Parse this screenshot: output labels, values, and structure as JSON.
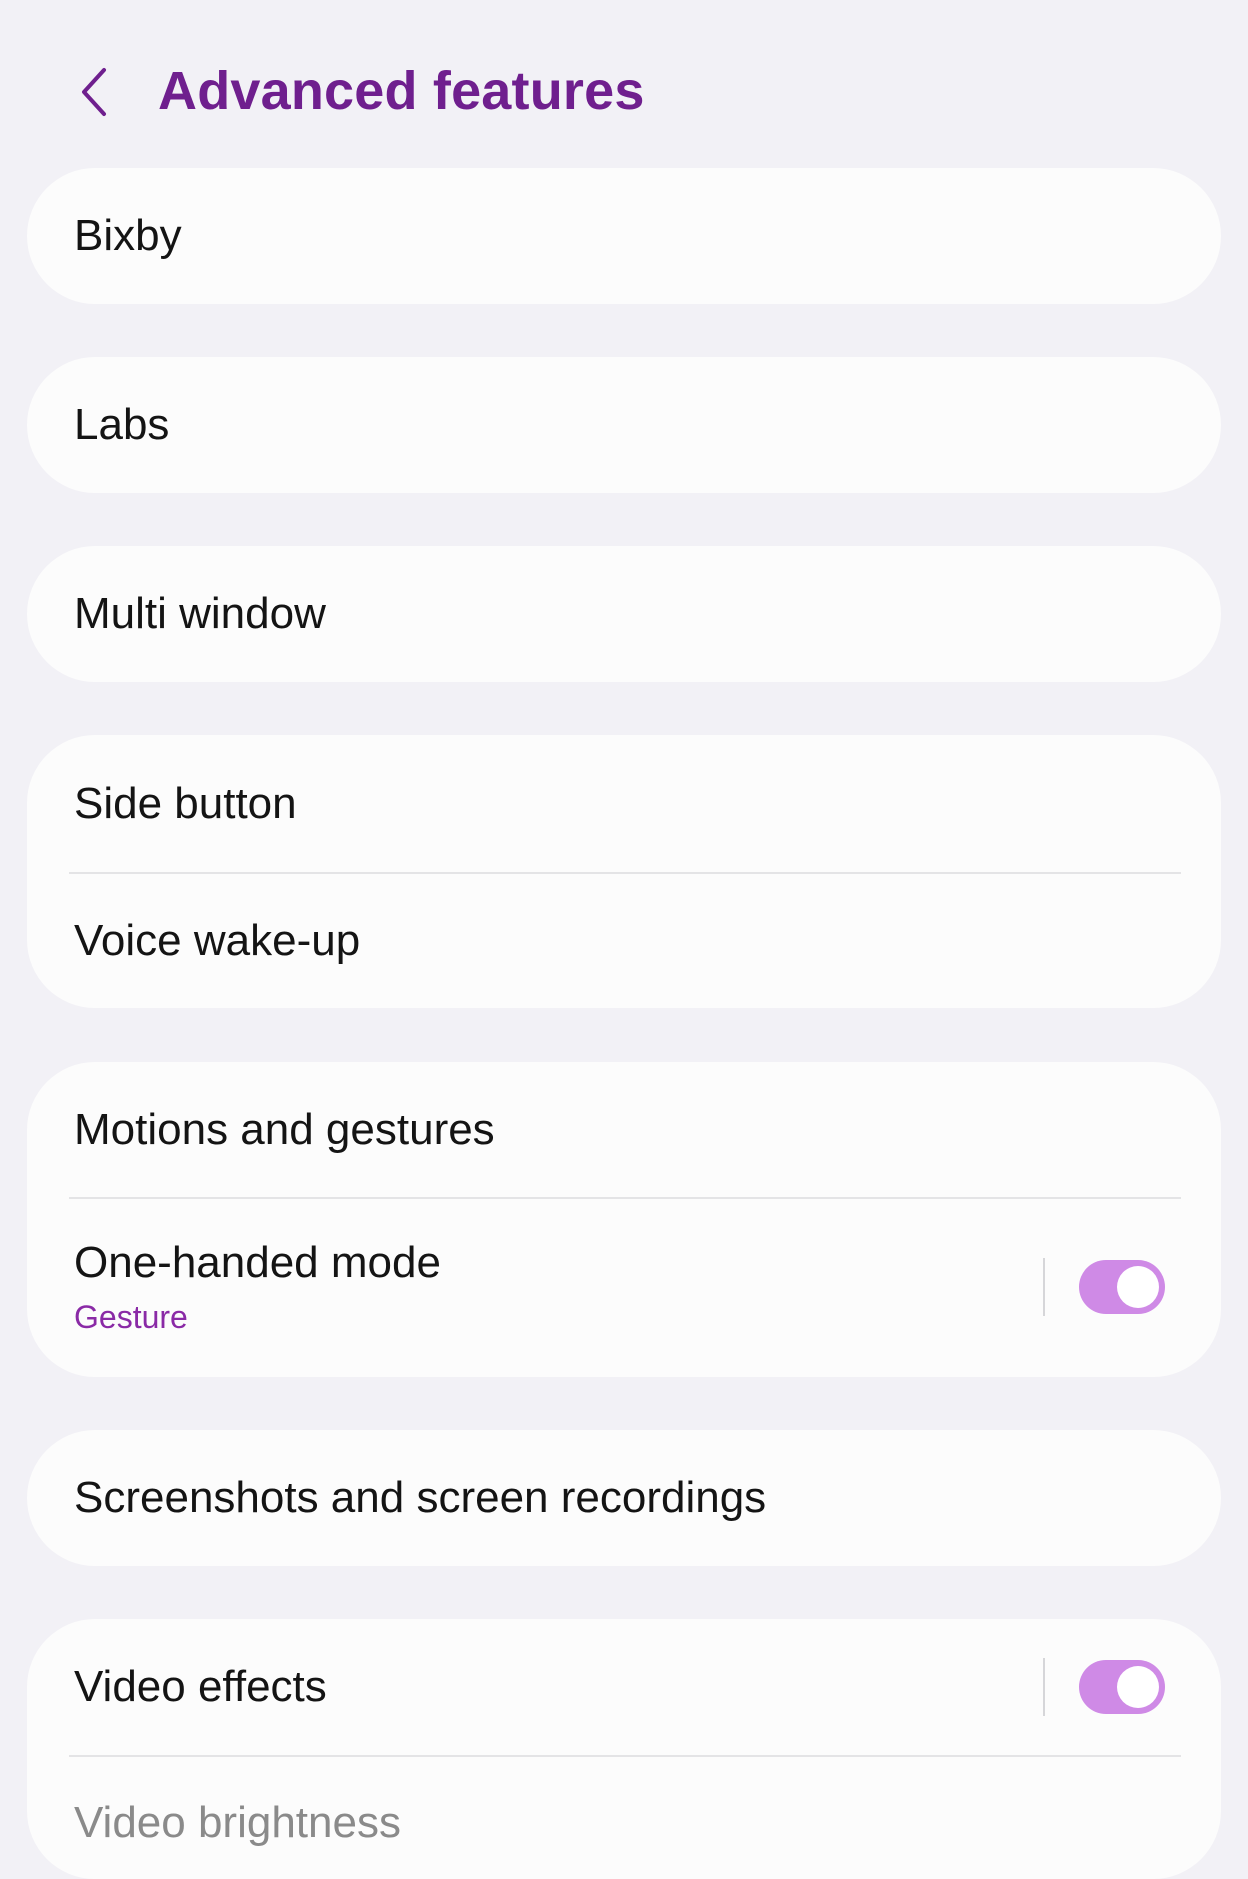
{
  "header": {
    "title": "Advanced features",
    "back_icon": "chevron-left-icon"
  },
  "colors": {
    "accent": "#6f1f8e",
    "subtitle": "#8a2aa6",
    "toggle_on": "#cf8ae6",
    "background": "#f2f1f6",
    "card": "#fcfcfc"
  },
  "items": {
    "bixby": {
      "label": "Bixby"
    },
    "labs": {
      "label": "Labs"
    },
    "multi_window": {
      "label": "Multi window"
    },
    "side_button": {
      "label": "Side button"
    },
    "voice_wakeup": {
      "label": "Voice wake-up"
    },
    "motions_gestures": {
      "label": "Motions and gestures"
    },
    "one_handed_mode": {
      "label": "One-handed mode",
      "subtitle": "Gesture",
      "enabled": true
    },
    "screenshots": {
      "label": "Screenshots and screen recordings"
    },
    "video_effects": {
      "label": "Video effects",
      "enabled": true
    },
    "video_brightness": {
      "label": "Video brightness"
    }
  }
}
